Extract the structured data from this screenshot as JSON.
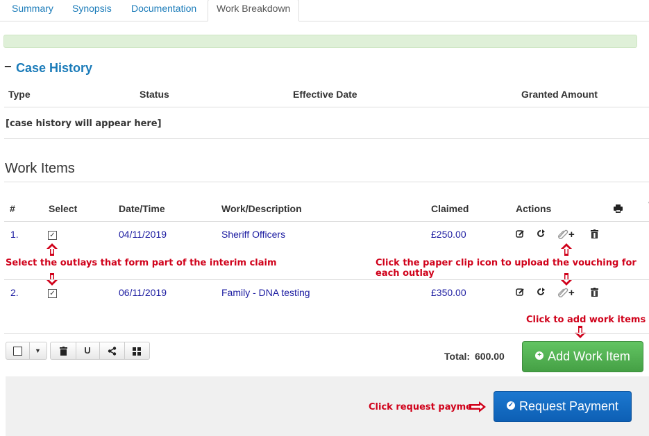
{
  "tabs": [
    {
      "label": "Summary"
    },
    {
      "label": "Synopsis"
    },
    {
      "label": "Documentation"
    },
    {
      "label": "Work Breakdown"
    }
  ],
  "case_history": {
    "toggle": "−",
    "title": "Case History",
    "columns": [
      "Type",
      "Status",
      "Effective Date",
      "Granted Amount"
    ],
    "placeholder": "[case history will appear here]"
  },
  "work_items": {
    "title": "Work Items",
    "columns": [
      "#",
      "Select",
      "Date/Time",
      "Work/Description",
      "Claimed",
      "Actions"
    ],
    "rows": [
      {
        "num": "1.",
        "date": "04/11/2019",
        "description": "Sheriff Officers",
        "claimed": "£250.00"
      },
      {
        "num": "2.",
        "date": "06/11/2019",
        "description": "Family - DNA testing",
        "claimed": "£350.00"
      }
    ],
    "total_label": "Total:",
    "total_value": "600.00",
    "add_button": "Add Work Item",
    "request_button": "Request Payment"
  },
  "annotations": {
    "select_outlays": "Select the outlays that form part of the interim claim",
    "paper_clip": "Click the paper clip icon to upload the vouching for each outlay",
    "add_items": "Click to add work items",
    "request_payment": "Click request payment"
  },
  "colors": {
    "link": "#1a1aa0",
    "accent": "#1a7bb9",
    "annotation": "#d0021b",
    "green_button": "#4cae4c",
    "blue_button": "#1467c4"
  }
}
